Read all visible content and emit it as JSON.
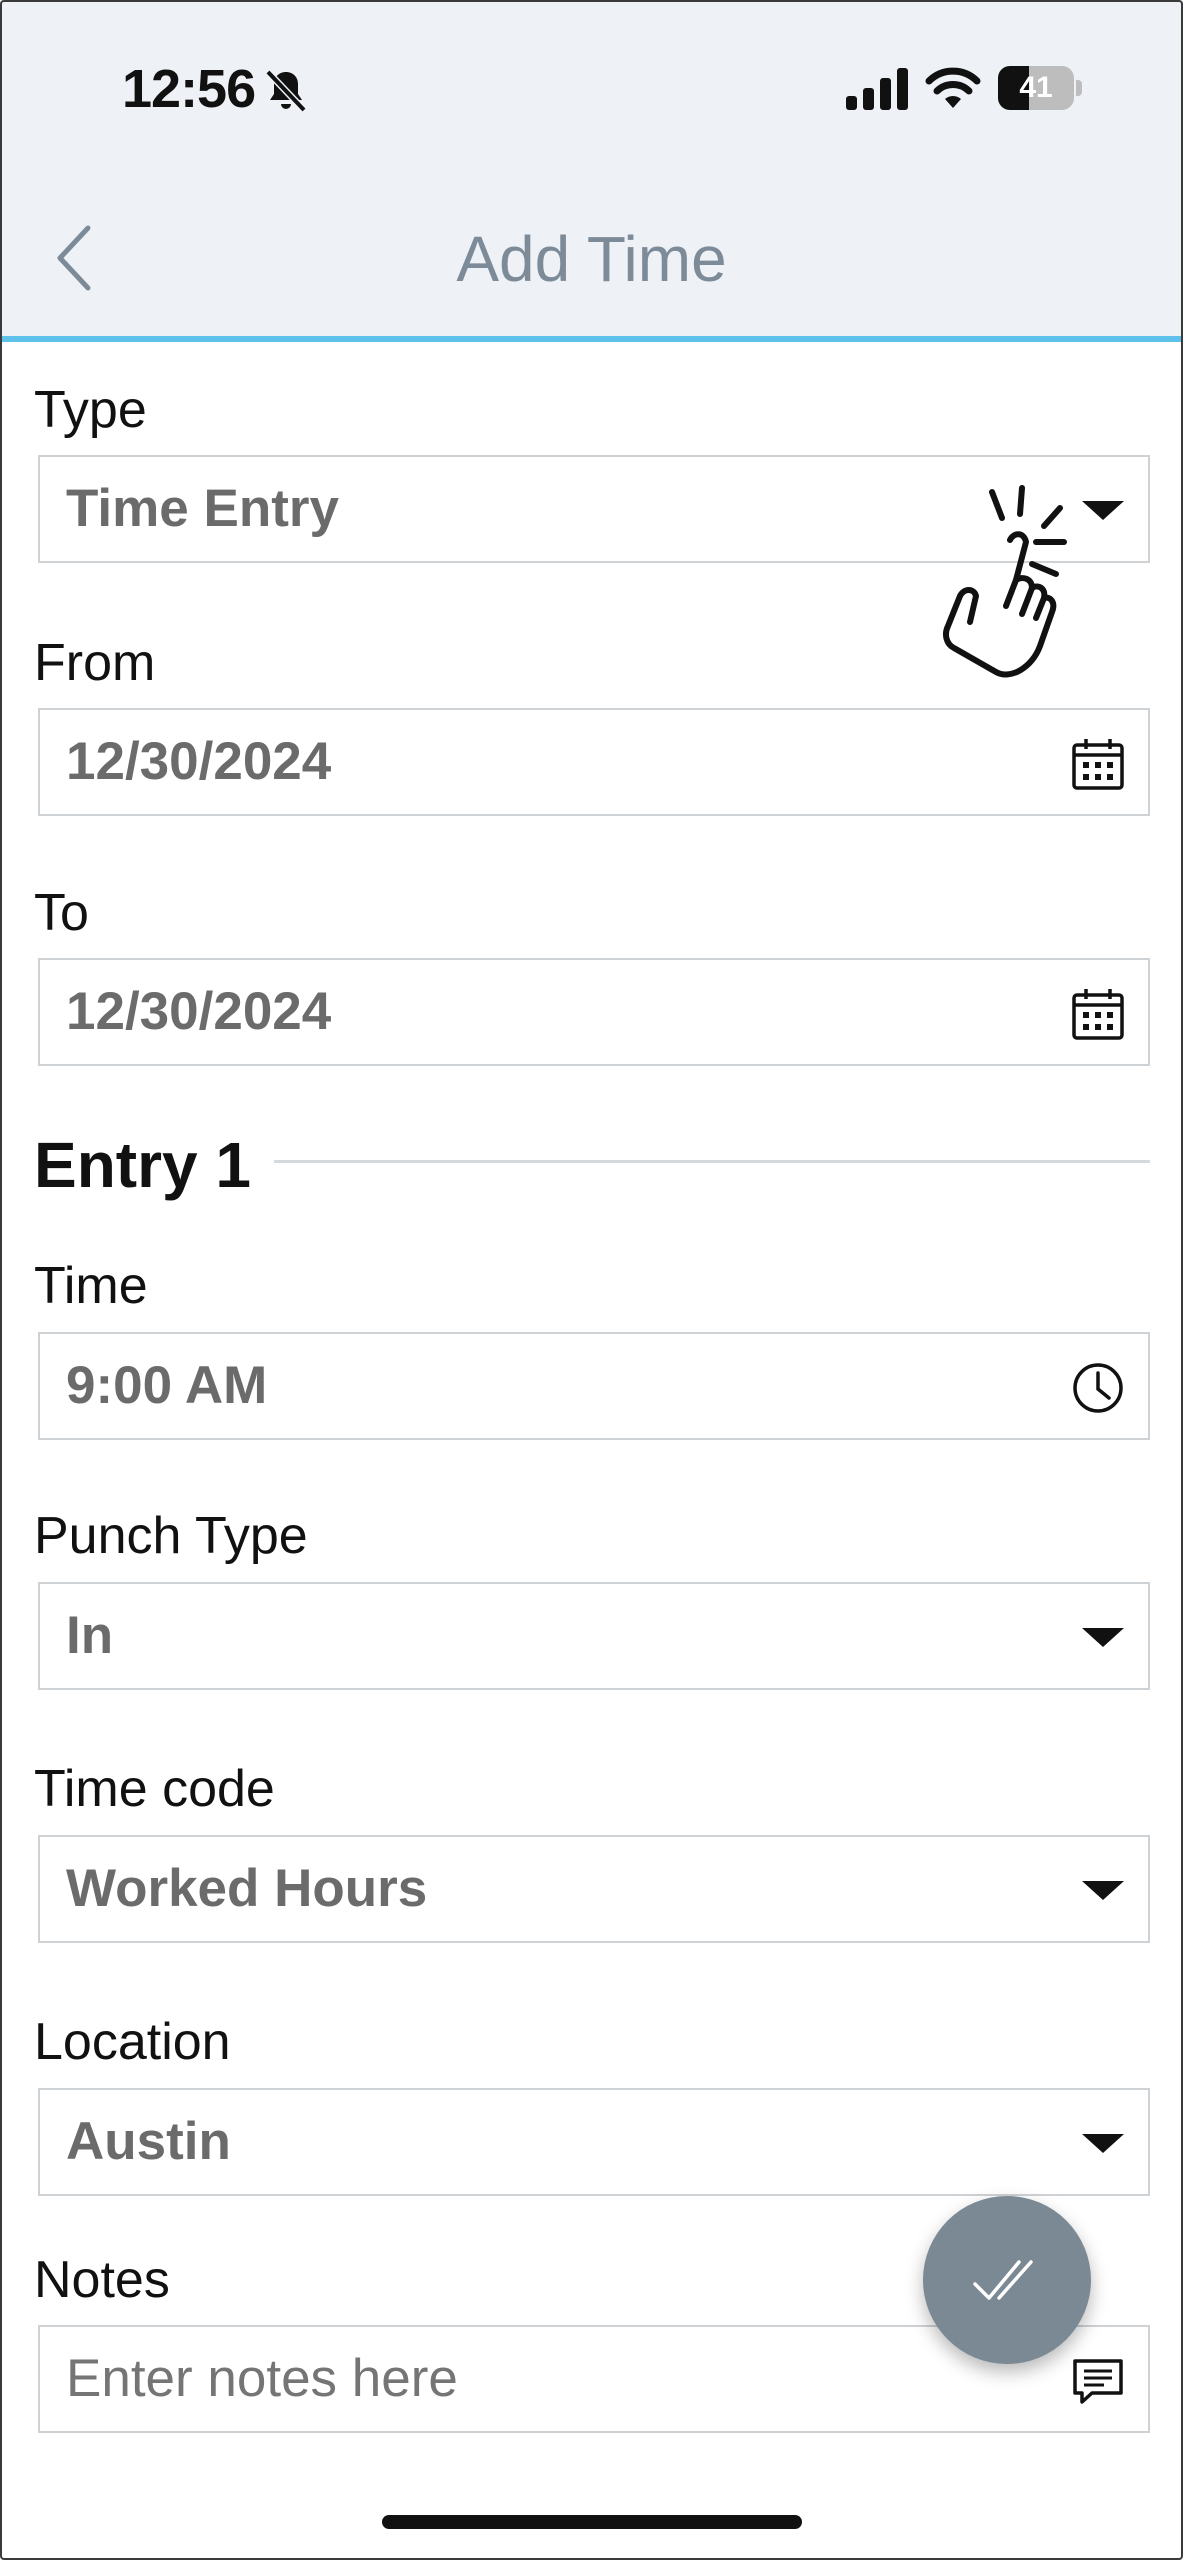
{
  "status_bar": {
    "time": "12:56",
    "battery_level": "41",
    "icons": [
      "bell-slash-icon",
      "cellular-signal-icon",
      "wifi-icon",
      "battery-icon"
    ]
  },
  "header": {
    "title": "Add Time",
    "back_icon": "chevron-left-icon",
    "accent_color": "#5ec1ea",
    "title_color": "#7d8b99"
  },
  "form": {
    "type": {
      "label": "Type",
      "value": "Time Entry",
      "icon": "caret-down-icon"
    },
    "from": {
      "label": "From",
      "value": "12/30/2024",
      "icon": "calendar-icon"
    },
    "to": {
      "label": "To",
      "value": "12/30/2024",
      "icon": "calendar-icon"
    },
    "entry": {
      "title": "Entry 1",
      "time": {
        "label": "Time",
        "value": "9:00 AM",
        "icon": "clock-icon"
      },
      "punch_type": {
        "label": "Punch Type",
        "value": "In",
        "icon": "caret-down-icon"
      },
      "time_code": {
        "label": "Time code",
        "value": "Worked Hours",
        "icon": "caret-down-icon"
      },
      "location": {
        "label": "Location",
        "value": "Austin",
        "icon": "caret-down-icon"
      },
      "notes": {
        "label": "Notes",
        "placeholder": "Enter notes here",
        "icon": "comment-icon"
      }
    }
  },
  "fab": {
    "icon": "double-check-icon",
    "color": "#7a8994"
  },
  "overlay": {
    "icon": "tap-hand-icon"
  }
}
